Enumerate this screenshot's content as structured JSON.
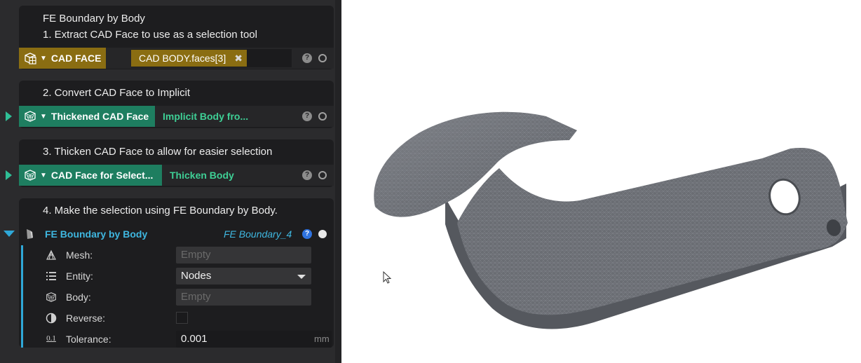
{
  "steps": [
    {
      "title": "FE Boundary by Body",
      "note": "1. Extract CAD Face to use as a selection tool",
      "chip_label": "CAD FACE",
      "chip_icon": "cad-face-icon",
      "value_tag": "CAD BODY.faces[3]"
    },
    {
      "note": "2. Convert CAD Face to Implicit",
      "chip_label": "Thickened CAD Face",
      "chip_icon": "implicit-body-icon",
      "link": "Implicit Body fro..."
    },
    {
      "note": "3. Thicken CAD Face to allow for easier selection",
      "chip_label": "CAD Face for Select...",
      "chip_icon": "implicit-body-icon",
      "link": "Thicken Body"
    },
    {
      "note": "4. Make the selection using FE Boundary by Body.",
      "node_label": "FE Boundary by Body",
      "node_icon": "boundary-icon",
      "output_name": "FE Boundary_4"
    }
  ],
  "help_symbol": "?",
  "properties": {
    "mesh": {
      "label": "Mesh:",
      "value": "Empty",
      "icon": "mesh-icon"
    },
    "entity": {
      "label": "Entity:",
      "value": "Nodes",
      "icon": "list-icon"
    },
    "body": {
      "label": "Body:",
      "value": "Empty",
      "icon": "body-icon"
    },
    "reverse": {
      "label": "Reverse:",
      "checked": false,
      "icon": "contrast-icon"
    },
    "tolerance": {
      "label": "Tolerance:",
      "value": "0.001",
      "unit": "mm",
      "icon": "tolerance-icon",
      "icon_text": "0.1"
    }
  },
  "colors": {
    "panel_bg": "#2b2b2d",
    "gold_chip": "#8a6d12",
    "teal_chip": "#1e7e60",
    "teal_text": "#3ecf95",
    "node_text": "#3fb7e0",
    "mesh_part": "#6e7178"
  }
}
